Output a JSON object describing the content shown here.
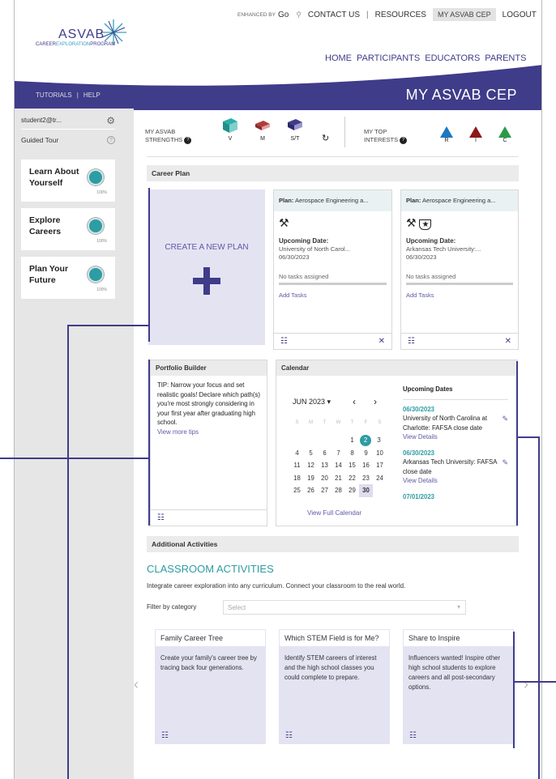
{
  "topnav": {
    "enhanced": "ENHANCED BY",
    "go": "Go",
    "contact": "CONTACT US",
    "sep": "|",
    "resources": "RESOURCES",
    "my_cep": "MY ASVAB CEP",
    "logout": "LOGOUT"
  },
  "logo": {
    "word": "ASVAB",
    "sub_a": "CAREER",
    "sub_b": "EXPLORATION",
    "sub_c": "PROGRAM"
  },
  "mainnav": [
    "HOME",
    "PARTICIPANTS",
    "EDUCATORS",
    "PARENTS"
  ],
  "subbar": {
    "tutorials": "TUTORIALS",
    "sep": "|",
    "help": "HELP",
    "title": "MY ASVAB CEP"
  },
  "sidebar": {
    "user": "student2@tr...",
    "tour": "Guided Tour",
    "cards": [
      {
        "l1": "Learn About",
        "l2": "Yourself",
        "pct": "100%"
      },
      {
        "l1": "Explore",
        "l2": "Careers",
        "pct": "100%"
      },
      {
        "l1": "Plan Your",
        "l2": "Future",
        "pct": "100%"
      }
    ]
  },
  "strengths": {
    "l1": "MY ASVAB",
    "l2": "STRENGTHS",
    "items": [
      "V",
      "M",
      "S/T"
    ],
    "int_l1": "MY TOP",
    "int_l2": "INTERESTS",
    "interests": [
      "R",
      "I",
      "C"
    ]
  },
  "career_plan": {
    "header": "Career Plan",
    "create": "CREATE A NEW PLAN",
    "plans": [
      {
        "label": "Plan:",
        "name": "Aerospace Engineering a...",
        "up": "Upcoming Date:",
        "school": "University of North Carol...",
        "date": "06/30/2023",
        "tasks": "No tasks assigned",
        "add": "Add Tasks"
      },
      {
        "label": "Plan:",
        "name": "Aerospace Engineering a...",
        "up": "Upcoming Date:",
        "school": "Arkansas Tech University:...",
        "date": "06/30/2023",
        "tasks": "No tasks assigned",
        "add": "Add Tasks"
      }
    ]
  },
  "portfolio": {
    "header": "Portfolio Builder",
    "tip": "TIP: Narrow your focus and set realistic goals! Declare which path(s) you're most strongly considering in your first year after graduating high school.",
    "more": "View more tips"
  },
  "calendar": {
    "header": "Calendar",
    "month": "JUN 2023 ▾",
    "days": [
      "S",
      "M",
      "T",
      "W",
      "T",
      "F",
      "S"
    ],
    "full": "View Full Calendar",
    "upcoming": "Upcoming Dates",
    "events": [
      {
        "date": "06/30/2023",
        "text": "University of North Carolina at Charlotte: FAFSA close date",
        "view": "View Details"
      },
      {
        "date": "06/30/2023",
        "text": "Arkansas Tech University: FAFSA close date",
        "view": "View Details"
      },
      {
        "date": "07/01/2023",
        "text": "",
        "view": ""
      }
    ]
  },
  "additional": {
    "header": "Additional Activities",
    "title": "CLASSROOM ACTIVITIES",
    "desc": "Integrate career exploration into any curriculum. Connect your classroom to the real world.",
    "filter": "Filter by category",
    "select": "Select",
    "cards": [
      {
        "title": "Family Career Tree",
        "body": "Create your family's career tree by tracing back four generations."
      },
      {
        "title": "Which STEM Field is for Me?",
        "body": "Identify STEM careers of interest and the high school classes you could complete to prepare."
      },
      {
        "title": "Share to Inspire",
        "body": "Influencers wanted! Inspire other high school students to explore careers and all post-secondary options."
      }
    ]
  }
}
